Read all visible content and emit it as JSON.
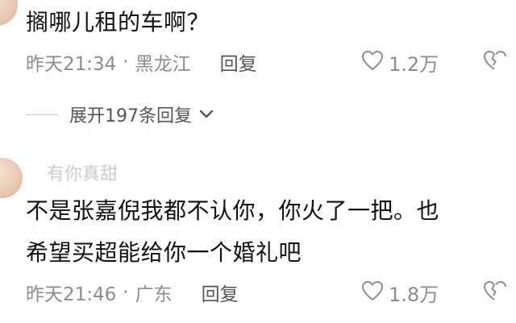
{
  "comment1": {
    "text": "搁哪儿租的车啊？",
    "time": "昨天21:34",
    "separator": "·",
    "location": "黑龙江",
    "reply_label": "回复",
    "likes": "1.2万"
  },
  "expand": {
    "label": "展开197条回复"
  },
  "comment2": {
    "author": "有你真甜",
    "line1": "不是张嘉倪我都不认你，你火了一把。也",
    "line2": "希望买超能给你一个婚礼吧",
    "time": "昨天21:46",
    "separator": "·",
    "location": "广东",
    "reply_label": "回复",
    "likes": "1.8万"
  },
  "icons": {
    "like": "heart-outline-icon",
    "dislike": "broken-heart-icon",
    "expand_chevron": "chevron-down-icon"
  }
}
